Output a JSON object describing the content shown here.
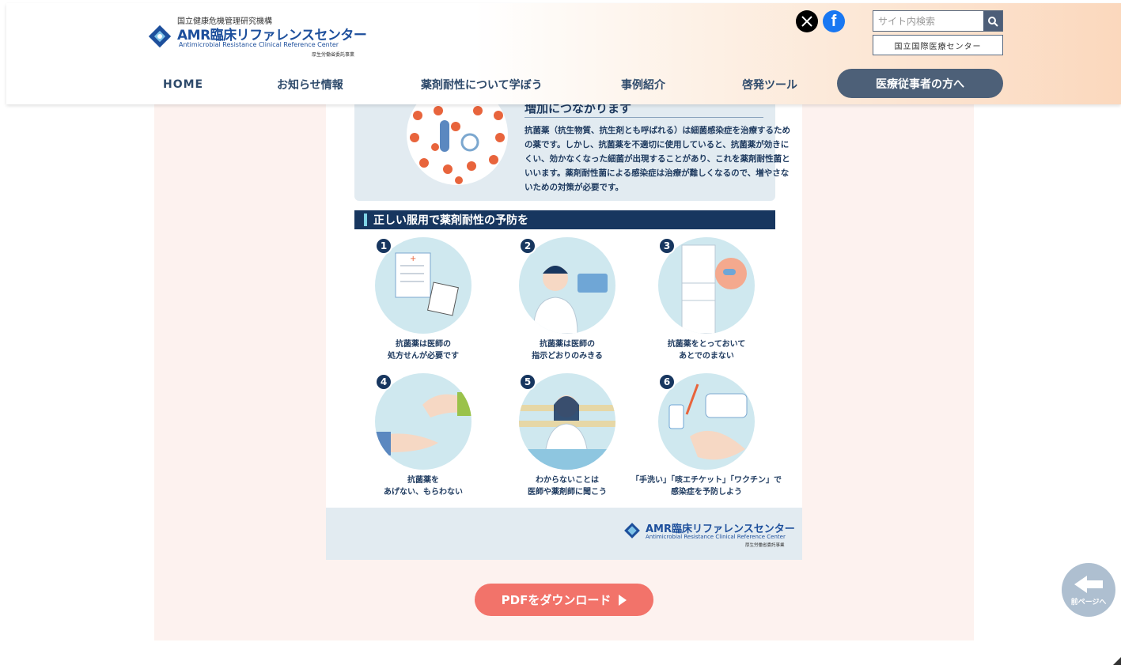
{
  "header": {
    "logo": {
      "org": "国立健康危機管理研究機構",
      "title": "AMR臨床リファレンスセンター",
      "subtitle_en": "Antimicrobial Resistance Clinical Reference Center",
      "ministry": "厚生労働省委託事業"
    },
    "sns": {
      "x_icon": "x-icon",
      "facebook_icon": "facebook-icon",
      "facebook_glyph": "f"
    },
    "search": {
      "placeholder": "サイト内検索"
    },
    "ncgm_label": "国立国際医療センター"
  },
  "nav": {
    "home": "HOME",
    "news": "お知らせ情報",
    "learn": "薬剤耐性について学ぼう",
    "cases": "事例紹介",
    "tools": "啓発ツール",
    "medical": "医療従事者の方へ"
  },
  "poster": {
    "intro_heading": "増加につながります",
    "intro_text": "抗菌薬（抗生物質、抗生剤とも呼ばれる）は細菌感染症を治療するための薬です。しかし、抗菌薬を不適切に使用していると、抗菌薬が効きにくい、効かなくなった細菌が出現することがあり、これを薬剤耐性菌といいます。薬剤耐性菌による感染症は治療が難しくなるので、増やさないための対策が必要です。",
    "section_title": "正しい服用で薬剤耐性の予防を",
    "steps": [
      {
        "num": "1",
        "caption": "抗菌薬は医師の\n処方せんが必要です"
      },
      {
        "num": "2",
        "caption": "抗菌薬は医師の\n指示どおりのみきる"
      },
      {
        "num": "3",
        "caption": "抗菌薬をとっておいて\nあとでのまない"
      },
      {
        "num": "4",
        "caption": "抗菌薬を\nあげない、もらわない"
      },
      {
        "num": "5",
        "caption": "わからないことは\n医師や薬剤師に聞こう"
      },
      {
        "num": "6",
        "caption": "「手洗い」「咳エチケット」「ワクチン」で\n感染症を予防しよう"
      }
    ],
    "footer_logo": {
      "title": "AMR臨床リファレンスセンター",
      "subtitle_en": "Antimicrobial Resistance Clinical Reference Center",
      "ministry": "厚生労働省委託事業"
    }
  },
  "pdf_button": "PDFをダウンロード",
  "back_button": "前ページへ",
  "colors": {
    "navy": "#17365f",
    "accent_coral": "#f2736a",
    "panel_bg": "#fdf2ef",
    "nav_pill": "#4d6078",
    "light_blue": "#cfe8ef"
  }
}
